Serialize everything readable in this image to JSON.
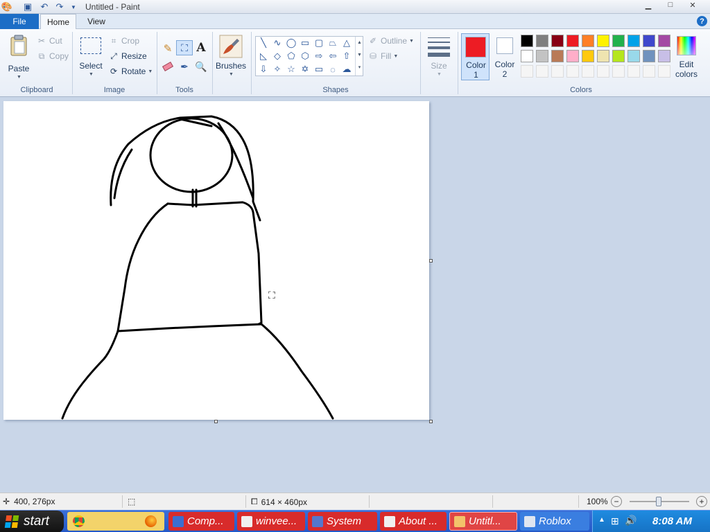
{
  "window": {
    "title": "Untitled - Paint"
  },
  "tabs": {
    "file": "File",
    "home": "Home",
    "view": "View"
  },
  "clipboard": {
    "group": "Clipboard",
    "paste": "Paste",
    "cut": "Cut",
    "copy": "Copy"
  },
  "image": {
    "group": "Image",
    "select": "Select",
    "crop": "Crop",
    "resize": "Resize",
    "rotate": "Rotate"
  },
  "tools": {
    "group": "Tools"
  },
  "brushes": {
    "label": "Brushes"
  },
  "shapes": {
    "group": "Shapes",
    "outline": "Outline",
    "fill": "Fill"
  },
  "size": {
    "label": "Size"
  },
  "colors": {
    "group": "Colors",
    "color1_label": "Color\n1",
    "color1_a": "Color",
    "color1_b": "1",
    "color2_a": "Color",
    "color2_b": "2",
    "edit_a": "Edit",
    "edit_b": "colors",
    "color1": "#ed1c24",
    "color2": "#ffffff",
    "palette_row1": [
      "#000000",
      "#7f7f7f",
      "#880015",
      "#ed1c24",
      "#ff7f27",
      "#fff200",
      "#22b14c",
      "#00a2e8",
      "#3f48cc",
      "#a349a4"
    ],
    "palette_row2": [
      "#ffffff",
      "#c3c3c3",
      "#b97a57",
      "#ffaec9",
      "#ffc90e",
      "#efe4b0",
      "#b5e61d",
      "#99d9ea",
      "#7092be",
      "#c8bfe7"
    ],
    "palette_row3": [
      "#f5f5f5",
      "#f5f5f5",
      "#f5f5f5",
      "#f5f5f5",
      "#f5f5f5",
      "#f5f5f5",
      "#f5f5f5",
      "#f5f5f5",
      "#f5f5f5",
      "#f5f5f5"
    ]
  },
  "status": {
    "cursor_pos": "400, 276px",
    "image_size": "614 × 460px",
    "zoom": "100%"
  },
  "taskbar": {
    "start": "start",
    "tasks": [
      "Comp...",
      "winvee...",
      "System",
      "About ...",
      "Untitl...",
      "Roblox"
    ],
    "clock": "8:08 AM"
  }
}
